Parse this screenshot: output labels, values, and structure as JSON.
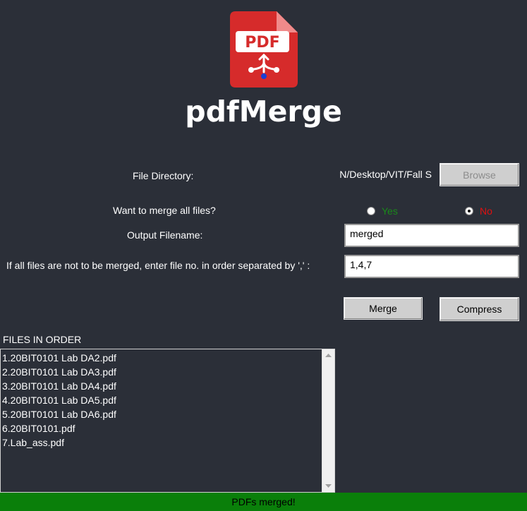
{
  "app": {
    "title": "pdfMerge",
    "logo_text": "PDF"
  },
  "directory": {
    "label": "File Directory:",
    "path": "N/Desktop/VIT/Fall S",
    "browse_label": "Browse"
  },
  "merge_all": {
    "label": "Want to merge all files?",
    "yes_label": "Yes",
    "no_label": "No",
    "selected": "No"
  },
  "output": {
    "label": "Output Filename:",
    "value": "merged"
  },
  "order": {
    "label": "If all files are not to be merged, enter file no. in order separated by ',' :",
    "value": "1,4,7"
  },
  "buttons": {
    "merge_label": "Merge",
    "compress_label": "Compress"
  },
  "files": {
    "heading": "FILES IN ORDER",
    "items": [
      "1.20BIT0101 Lab DA2.pdf",
      "2.20BIT0101 Lab DA3.pdf",
      "3.20BIT0101 Lab DA4.pdf",
      "4.20BIT0101 Lab DA5.pdf",
      "5.20BIT0101 Lab DA6.pdf",
      "6.20BIT0101.pdf",
      "7.Lab_ass.pdf"
    ]
  },
  "status": {
    "text": "PDFs merged!"
  },
  "colors": {
    "background": "#2b2f38",
    "logo_red": "#d62b2b",
    "status_green": "#0a7f0a",
    "yes_green": "#1a8a1a",
    "no_red": "#e01010"
  }
}
